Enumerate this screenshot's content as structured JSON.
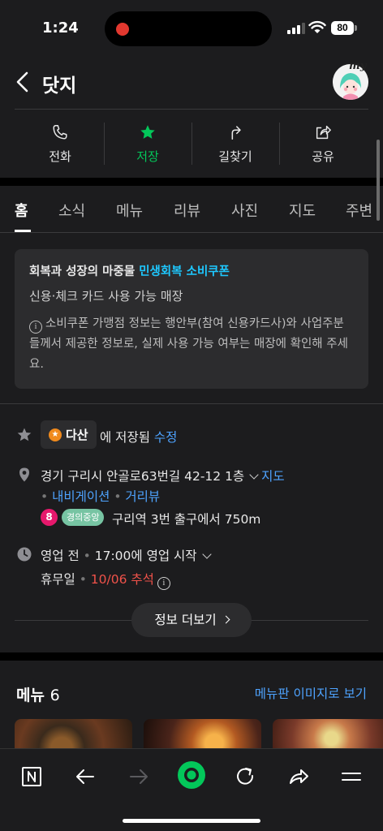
{
  "status_bar": {
    "time": "1:24",
    "battery": "80"
  },
  "header": {
    "title": "닷지",
    "avatar_tag": "my"
  },
  "actions": [
    {
      "label": "전화",
      "icon": "phone-icon"
    },
    {
      "label": "저장",
      "icon": "star-icon",
      "active": true
    },
    {
      "label": "길찾기",
      "icon": "directions-icon"
    },
    {
      "label": "공유",
      "icon": "share-icon"
    }
  ],
  "tabs": [
    "홈",
    "소식",
    "메뉴",
    "리뷰",
    "사진",
    "지도",
    "주변"
  ],
  "notice": {
    "title_prefix": "회복과 성장의 마중물",
    "title_highlight": "민생회복 소비쿠폰",
    "subtitle": "신용·체크 카드 사용 가능 매장",
    "body": "소비쿠폰 가맹점 정보는 행안부(참여 신용카드사)와 사업주분들께서 제공한 정보로, 실제 사용 가능 여부는 매장에 확인해 주세요."
  },
  "saved": {
    "list_name": "다산",
    "suffix": "에 저장됨",
    "edit": "수정"
  },
  "address": {
    "text": "경기 구리시 안골로63번길 42-12 1층",
    "map_link": "지도",
    "navi": "내비게이션",
    "street_view": "거리뷰",
    "subway_line_number": "8",
    "subway_line_name": "경의중앙",
    "subway_distance": "구리역 3번 출구에서 750m"
  },
  "hours": {
    "status": "영업 전",
    "opens": "17:00에 영업 시작",
    "holiday_label": "휴무일",
    "holiday_value": "10/06 추석"
  },
  "more_button": "정보 더보기",
  "menu": {
    "title": "메뉴",
    "count": "6",
    "image_link": "메뉴판 이미지로 보기"
  },
  "colors": {
    "accent_green": "#03c75a",
    "link_blue": "#4ea3ff",
    "highlight_cyan": "#1ec8ff",
    "warning_red": "#f0524a"
  },
  "toolbar": [
    "naver-n-icon",
    "back-arrow-icon",
    "forward-arrow-icon",
    "naver-green-dot-icon",
    "refresh-icon",
    "share-arrow-icon",
    "menu-lines-icon"
  ]
}
